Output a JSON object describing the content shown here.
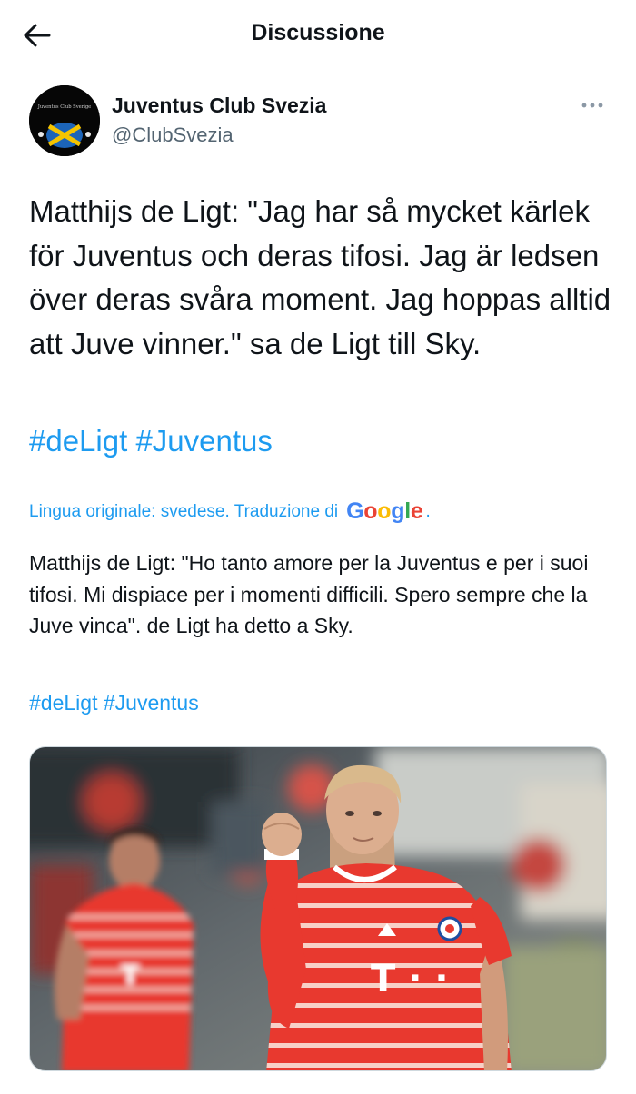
{
  "header": {
    "title": "Discussione",
    "back_icon": "arrow-left-icon"
  },
  "author": {
    "name": "Juventus Club Svezia",
    "handle": "@ClubSvezia",
    "avatar_text": "Juventus Club Sverige",
    "more_icon": "more-horizontal-icon"
  },
  "tweet": {
    "text": "Matthijs de Ligt: \"Jag har så mycket kärlek för Juventus och deras tifosi. Jag är ledsen över deras svåra moment. Jag hoppas alltid att Juve vinner.\" sa de Ligt till Sky.",
    "hashtags": [
      "#deLigt",
      "#Juventus"
    ]
  },
  "translation": {
    "note": "Lingua originale: svedese. Traduzione di",
    "provider": "Google",
    "note_end": ".",
    "text": "Matthijs de Ligt: \"Ho tanto amore per la Juventus e per i suoi tifosi. Mi dispiace per i momenti difficili. Spero sempre che la Juve vinca\". de Ligt ha detto a Sky.",
    "hashtags": [
      "#deLigt",
      "#Juventus"
    ]
  },
  "media": {
    "shirt_sponsor": "T · ·"
  },
  "colors": {
    "link": "#1d9bf0",
    "text": "#0f1419",
    "secondary": "#536471",
    "jersey": "#e8392f"
  }
}
